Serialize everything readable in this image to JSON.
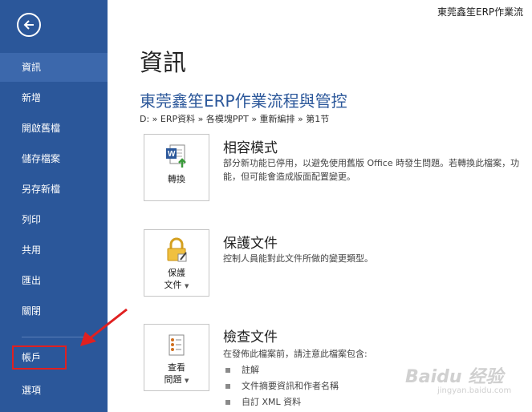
{
  "window": {
    "doc_title": "東莞鑫笙ERP作業流"
  },
  "sidebar": {
    "back_icon": "arrow-left-icon",
    "items": [
      {
        "label": "資訊",
        "active": true
      },
      {
        "label": "新增"
      },
      {
        "label": "開啟舊檔"
      },
      {
        "label": "儲存檔案"
      },
      {
        "label": "另存新檔"
      },
      {
        "label": "列印"
      },
      {
        "label": "共用"
      },
      {
        "label": "匯出"
      },
      {
        "label": "關閉"
      }
    ],
    "bottom_items": [
      {
        "label": "帳戶"
      },
      {
        "label": "選項"
      }
    ],
    "bg_color": "#2b579a"
  },
  "main": {
    "page_title": "資訊",
    "file_name": "東莞鑫笙ERP作業流程與管控",
    "file_path": "D: » ERP資料 » 各模塊PPT » 重新編排 » 第1节",
    "sections": [
      {
        "title": "相容模式",
        "desc": "部分新功能已停用，以避免使用舊版 Office 時發生問題。若轉換此檔案，功能，但可能會造成版面配置變更。",
        "button_label": "轉換",
        "button_icon": "word-convert-icon"
      },
      {
        "title": "保護文件",
        "desc": "控制人員能對此文件所做的變更類型。",
        "button_label_line1": "保護",
        "button_label_line2": "文件",
        "button_icon": "lock-icon"
      },
      {
        "title": "檢查文件",
        "desc": "在發佈此檔案前，請注意此檔案包含:",
        "button_label_line1": "查看",
        "button_label_line2": "問題",
        "button_icon": "checklist-icon",
        "bullets": [
          "註解",
          "文件摘要資訊和作者名稱",
          "自訂 XML 資料"
        ]
      }
    ]
  },
  "watermark": {
    "text": "Baidu 经验",
    "sub": "jingyan.baidu.com"
  }
}
